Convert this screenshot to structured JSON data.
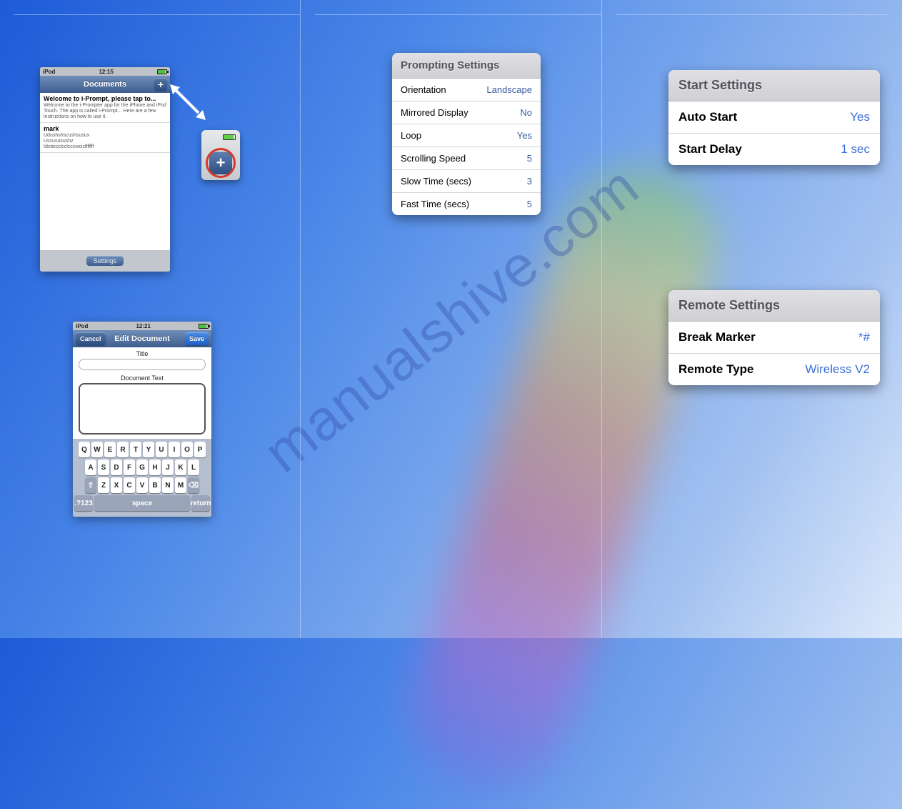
{
  "watermark": "manualshive.com",
  "ipod1": {
    "device": "iPod",
    "time": "12:15",
    "title": "Documents",
    "plus": "+",
    "doc1_title": "Welcome to i-Prompt, please tap to...",
    "doc1_preview": "Welcome to the i-Prompter app for the iPhone and iPod Touch. The app is called i-Prompt... Here are a few instructions on how to use it.",
    "doc2_title": "mark",
    "doc2_preview1": "Udushshscushsusux",
    "doc2_preview2": "Uscususushz",
    "doc2_preview3": "Idcteicclcclcccwciclffffff",
    "settings": "Settings"
  },
  "ipod2": {
    "device": "iPod",
    "time": "12:21",
    "cancel": "Cancel",
    "title": "Edit Document",
    "save": "Save",
    "title_lbl": "Title",
    "text_lbl": "Document Text",
    "row1": [
      "Q",
      "W",
      "E",
      "R",
      "T",
      "Y",
      "U",
      "I",
      "O",
      "P"
    ],
    "row2": [
      "A",
      "S",
      "D",
      "F",
      "G",
      "H",
      "J",
      "K",
      "L"
    ],
    "row3": [
      "⇧",
      "Z",
      "X",
      "C",
      "V",
      "B",
      "N",
      "M",
      "⌫"
    ],
    "k123": ".?123",
    "space": "space",
    "return": "return"
  },
  "callout_plus": "+",
  "prompting": {
    "header": "Prompting Settings",
    "rows": [
      {
        "label": "Orientation",
        "value": "Landscape"
      },
      {
        "label": "Mirrored Display",
        "value": "No"
      },
      {
        "label": "Loop",
        "value": "Yes"
      },
      {
        "label": "Scrolling Speed",
        "value": "5"
      },
      {
        "label": "Slow Time (secs)",
        "value": "3"
      },
      {
        "label": "Fast Time (secs)",
        "value": "5"
      }
    ]
  },
  "start": {
    "header": "Start Settings",
    "rows": [
      {
        "label": "Auto Start",
        "value": "Yes"
      },
      {
        "label": "Start Delay",
        "value": "1 sec"
      }
    ]
  },
  "remote": {
    "header": "Remote Settings",
    "rows": [
      {
        "label": "Break Marker",
        "value": "*#"
      },
      {
        "label": "Remote Type",
        "value": "Wireless V2"
      }
    ]
  }
}
